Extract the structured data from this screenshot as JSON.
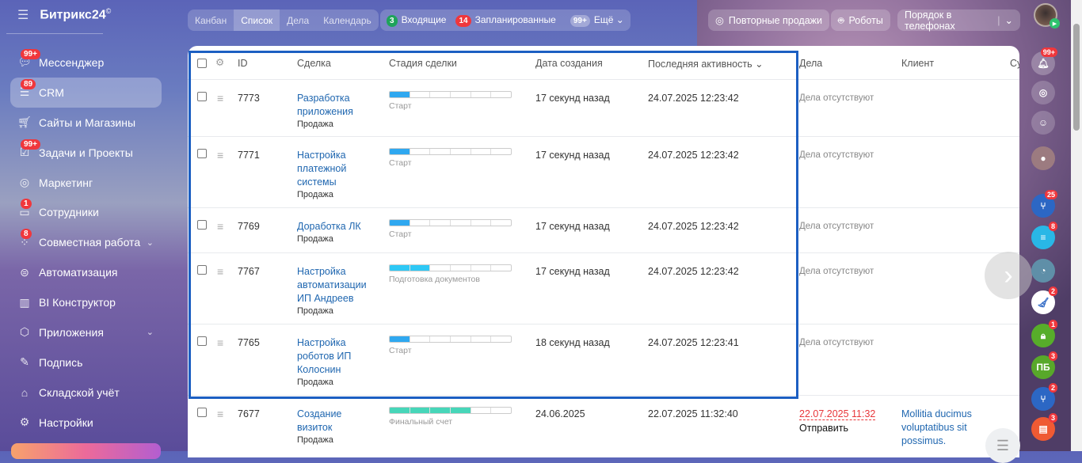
{
  "app": {
    "title": "Битрикс24",
    "logo_mark": "©"
  },
  "sidebar": {
    "items": [
      {
        "label": "Мессенджер",
        "badge": "99+",
        "icon": "chat-icon"
      },
      {
        "label": "CRM",
        "badge": "89",
        "icon": "filter-icon",
        "active": true
      },
      {
        "label": "Сайты и Магазины",
        "badge": null,
        "icon": "cart-icon"
      },
      {
        "label": "Задачи и Проекты",
        "badge": "99+",
        "icon": "task-icon"
      },
      {
        "label": "Маркетинг",
        "badge": null,
        "icon": "target-icon"
      },
      {
        "label": "Сотрудники",
        "badge": "1",
        "icon": "id-card-icon"
      },
      {
        "label": "Совместная работа",
        "badge": "8",
        "icon": "collab-icon",
        "chevron": true
      },
      {
        "label": "Автоматизация",
        "badge": null,
        "icon": "robot-icon"
      },
      {
        "label": "BI Конструктор",
        "badge": null,
        "icon": "bar-chart-icon"
      },
      {
        "label": "Приложения",
        "badge": null,
        "icon": "box-icon",
        "chevron": true
      },
      {
        "label": "Подпись",
        "badge": null,
        "icon": "pen-icon"
      },
      {
        "label": "Складской учёт",
        "badge": null,
        "icon": "warehouse-icon"
      },
      {
        "label": "Настройки",
        "badge": null,
        "icon": "gear-icon"
      }
    ]
  },
  "toolbar": {
    "views": [
      "Канбан",
      "Список",
      "Дела",
      "Календарь"
    ],
    "active_view": "Список",
    "incoming": {
      "count": "3",
      "label": "Входящие"
    },
    "planned": {
      "count": "14",
      "label": "Запланированные"
    },
    "more": {
      "count": "99+",
      "label": "Ещё"
    },
    "repeat_sales": "Повторные продажи",
    "robots": "Роботы",
    "phone_order": "Порядок в телефонах"
  },
  "table": {
    "headers": {
      "id": "ID",
      "deal": "Сделка",
      "stage": "Стадия сделки",
      "created": "Дата создания",
      "activity": "Последняя активность",
      "tasks": "Дела",
      "client": "Клиент",
      "sum": "Су"
    },
    "rows": [
      {
        "id": "7773",
        "title": "Разработка приложения",
        "type": "Продажа",
        "stage": "Старт",
        "progress": 1,
        "color": "#2fa8f0",
        "created": "17 секунд назад",
        "activity": "24.07.2025 12:23:42",
        "tasks": "Дела отсутствуют",
        "client": ""
      },
      {
        "id": "7771",
        "title": "Настройка платежной системы",
        "type": "Продажа",
        "stage": "Старт",
        "progress": 1,
        "color": "#2fa8f0",
        "created": "17 секунд назад",
        "activity": "24.07.2025 12:23:42",
        "tasks": "Дела отсутствуют",
        "client": ""
      },
      {
        "id": "7769",
        "title": "Доработка ЛК",
        "type": "Продажа",
        "stage": "Старт",
        "progress": 1,
        "color": "#2fa8f0",
        "created": "17 секунд назад",
        "activity": "24.07.2025 12:23:42",
        "tasks": "Дела отсутствуют",
        "client": ""
      },
      {
        "id": "7767",
        "title": "Настройка автоматизации ИП Андреев",
        "type": "Продажа",
        "stage": "Подготовка документов",
        "progress": 2,
        "color": "#2ec8f5",
        "created": "17 секунд назад",
        "activity": "24.07.2025 12:23:42",
        "tasks": "Дела отсутствуют",
        "client": ""
      },
      {
        "id": "7765",
        "title": "Настройка роботов ИП Колоснин",
        "type": "Продажа",
        "stage": "Старт",
        "progress": 1,
        "color": "#2fa8f0",
        "created": "18 секунд назад",
        "activity": "24.07.2025 12:23:41",
        "tasks": "Дела отсутствуют",
        "client": ""
      },
      {
        "id": "7677",
        "title": "Создание визиток",
        "type": "Продажа",
        "stage": "Финальный счет",
        "progress": 4,
        "color": "#47d6b9",
        "created": "24.06.2025",
        "activity": "22.07.2025 11:32:40",
        "tasks_date": "22.07.2025 11:32",
        "tasks_action": "Отправить",
        "client": "Mollitia ducimus voluptatibus sit possimus."
      }
    ]
  },
  "right_panel": [
    {
      "icon": "bell-icon",
      "badge": "99+",
      "color": "rgba(255,255,255,.25)"
    },
    {
      "icon": "repeat-icon",
      "badge": null,
      "color": "rgba(255,255,255,.2)"
    },
    {
      "icon": "support-icon",
      "badge": null,
      "color": "rgba(255,255,255,.2)"
    },
    {
      "icon": "group-avatar-icon",
      "badge": null,
      "color": "#9c7b80"
    },
    {
      "icon": "flow-icon",
      "badge": "25",
      "color": "#2c67c4"
    },
    {
      "icon": "chat-bubble-icon",
      "badge": "8",
      "color": "#29b7e6"
    },
    {
      "icon": "user-clock-icon",
      "badge": null,
      "color": "#5f8fa8"
    },
    {
      "icon": "broom-icon",
      "badge": "2",
      "color": "#ffffff"
    },
    {
      "icon": "lock-icon",
      "badge": "1",
      "color": "#57ad2a"
    },
    {
      "icon": "pb-icon",
      "badge": "3",
      "color": "#58a82a",
      "text": "ПБ"
    },
    {
      "icon": "flow-icon",
      "badge": "2",
      "color": "#2c67c4"
    },
    {
      "icon": "contact-card-icon",
      "badge": "3",
      "color": "#ef5a33"
    }
  ]
}
